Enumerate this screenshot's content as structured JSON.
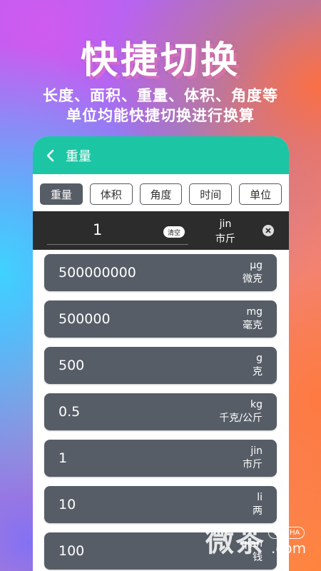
{
  "promo": {
    "headline": "快捷切换",
    "subtitle_line1": "长度、面积、重量、体积、角度等",
    "subtitle_line2": "单位均能快捷切换进行换算"
  },
  "app": {
    "title": "重量",
    "accent_color": "#1cc6a4",
    "back_icon": "chevron-left-icon",
    "tabs": [
      {
        "label": "重量",
        "active": true
      },
      {
        "label": "体积",
        "active": false
      },
      {
        "label": "角度",
        "active": false
      },
      {
        "label": "时间",
        "active": false
      },
      {
        "label": "单位",
        "active": false
      }
    ]
  },
  "input": {
    "value": "1",
    "clear_label": "清空",
    "unit_code": "jin",
    "unit_name": "市斤",
    "close_icon": "close-icon"
  },
  "results": [
    {
      "value": "500000000",
      "unit_code": "μg",
      "unit_name": "微克"
    },
    {
      "value": "500000",
      "unit_code": "mg",
      "unit_name": "毫克"
    },
    {
      "value": "500",
      "unit_code": "g",
      "unit_name": "克"
    },
    {
      "value": "0.5",
      "unit_code": "kg",
      "unit_name": "千克/公斤"
    },
    {
      "value": "1",
      "unit_code": "jin",
      "unit_name": "市斤"
    },
    {
      "value": "10",
      "unit_code": "li",
      "unit_name": "两"
    },
    {
      "value": "100",
      "unit_code": "qian",
      "unit_name": "钱"
    }
  ],
  "watermark": {
    "text": "微茶",
    "badge": "WXCHA",
    "domain": ".com"
  }
}
